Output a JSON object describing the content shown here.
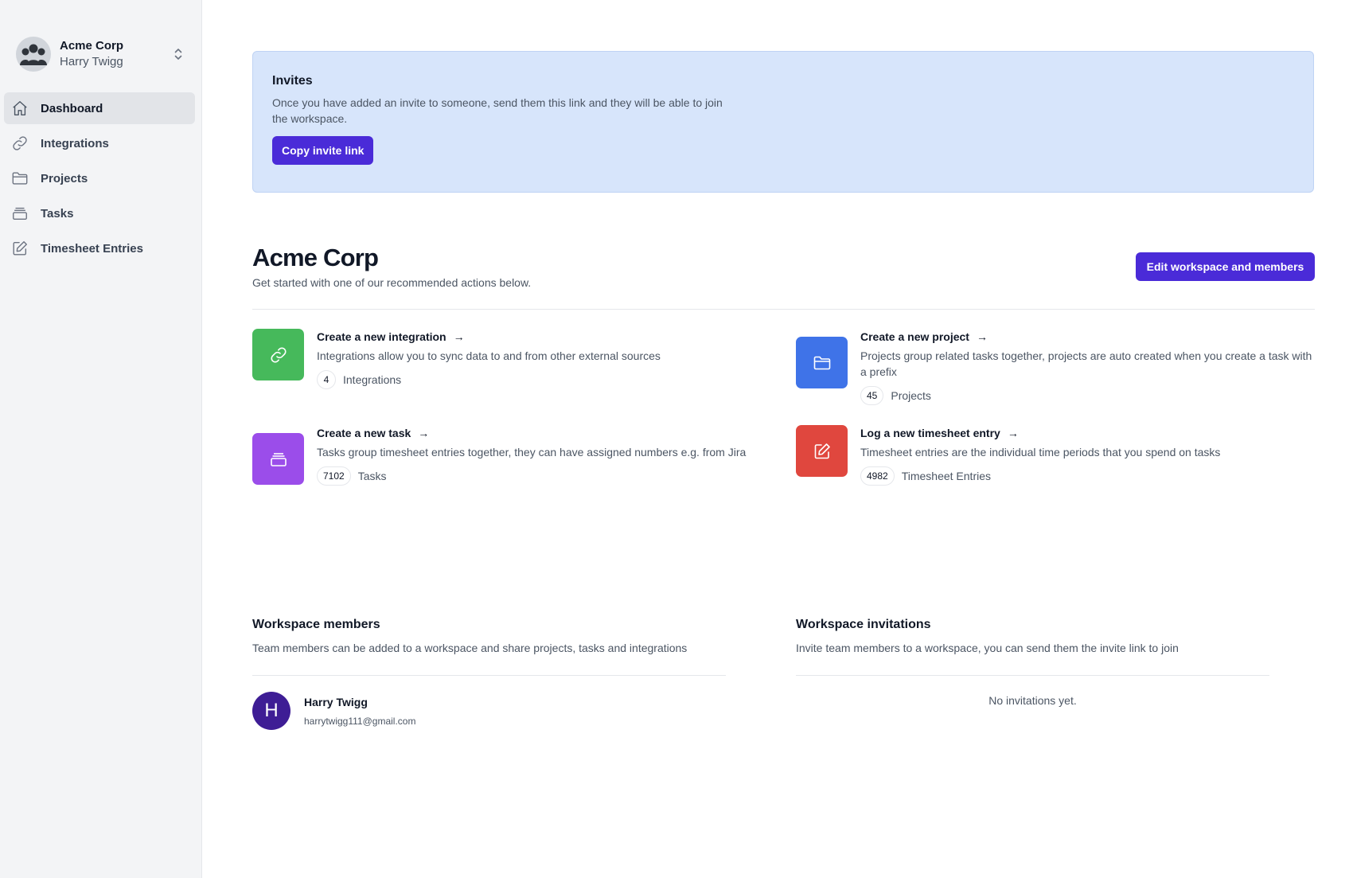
{
  "sidebar": {
    "workspace_name": "Acme Corp",
    "user_name": "Harry Twigg",
    "nav": [
      {
        "label": "Dashboard",
        "icon": "home-icon",
        "active": true
      },
      {
        "label": "Integrations",
        "icon": "link-icon"
      },
      {
        "label": "Projects",
        "icon": "folder-icon"
      },
      {
        "label": "Tasks",
        "icon": "archive-icon"
      },
      {
        "label": "Timesheet Entries",
        "icon": "pencil-square-icon"
      }
    ]
  },
  "invites": {
    "title": "Invites",
    "description": "Once you have added an invite to someone, send them this link and they will be able to join the workspace.",
    "button": "Copy invite link"
  },
  "workspace": {
    "title": "Acme Corp",
    "subtitle": "Get started with one of our recommended actions below.",
    "edit_button": "Edit workspace and members"
  },
  "actions": [
    {
      "title": "Create a new integration",
      "description": "Integrations allow you to sync data to and from other external sources",
      "count": "4",
      "count_label": "Integrations",
      "color": "#46b95b",
      "icon": "link-icon"
    },
    {
      "title": "Create a new project",
      "description": "Projects group related tasks together, projects are auto created when you create a task with a prefix",
      "count": "45",
      "count_label": "Projects",
      "color": "#3f73e8",
      "icon": "folder-icon"
    },
    {
      "title": "Create a new task",
      "description": "Tasks group timesheet entries together, they can have assigned numbers e.g. from Jira",
      "count": "7102",
      "count_label": "Tasks",
      "color": "#9b4dea",
      "icon": "archive-icon"
    },
    {
      "title": "Log a new timesheet entry",
      "description": "Timesheet entries are the individual time periods that you spend on tasks",
      "count": "4982",
      "count_label": "Timesheet Entries",
      "color": "#e0473e",
      "icon": "pencil-square-icon"
    }
  ],
  "members": {
    "title": "Workspace members",
    "description": "Team members can be added to a workspace and share projects, tasks and integrations",
    "list": [
      {
        "initial": "H",
        "name": "Harry Twigg",
        "email": "harrytwigg111@gmail.com"
      }
    ]
  },
  "invitations": {
    "title": "Workspace invitations",
    "description": "Invite team members to a workspace, you can send them the invite link to join",
    "empty": "No invitations yet."
  }
}
